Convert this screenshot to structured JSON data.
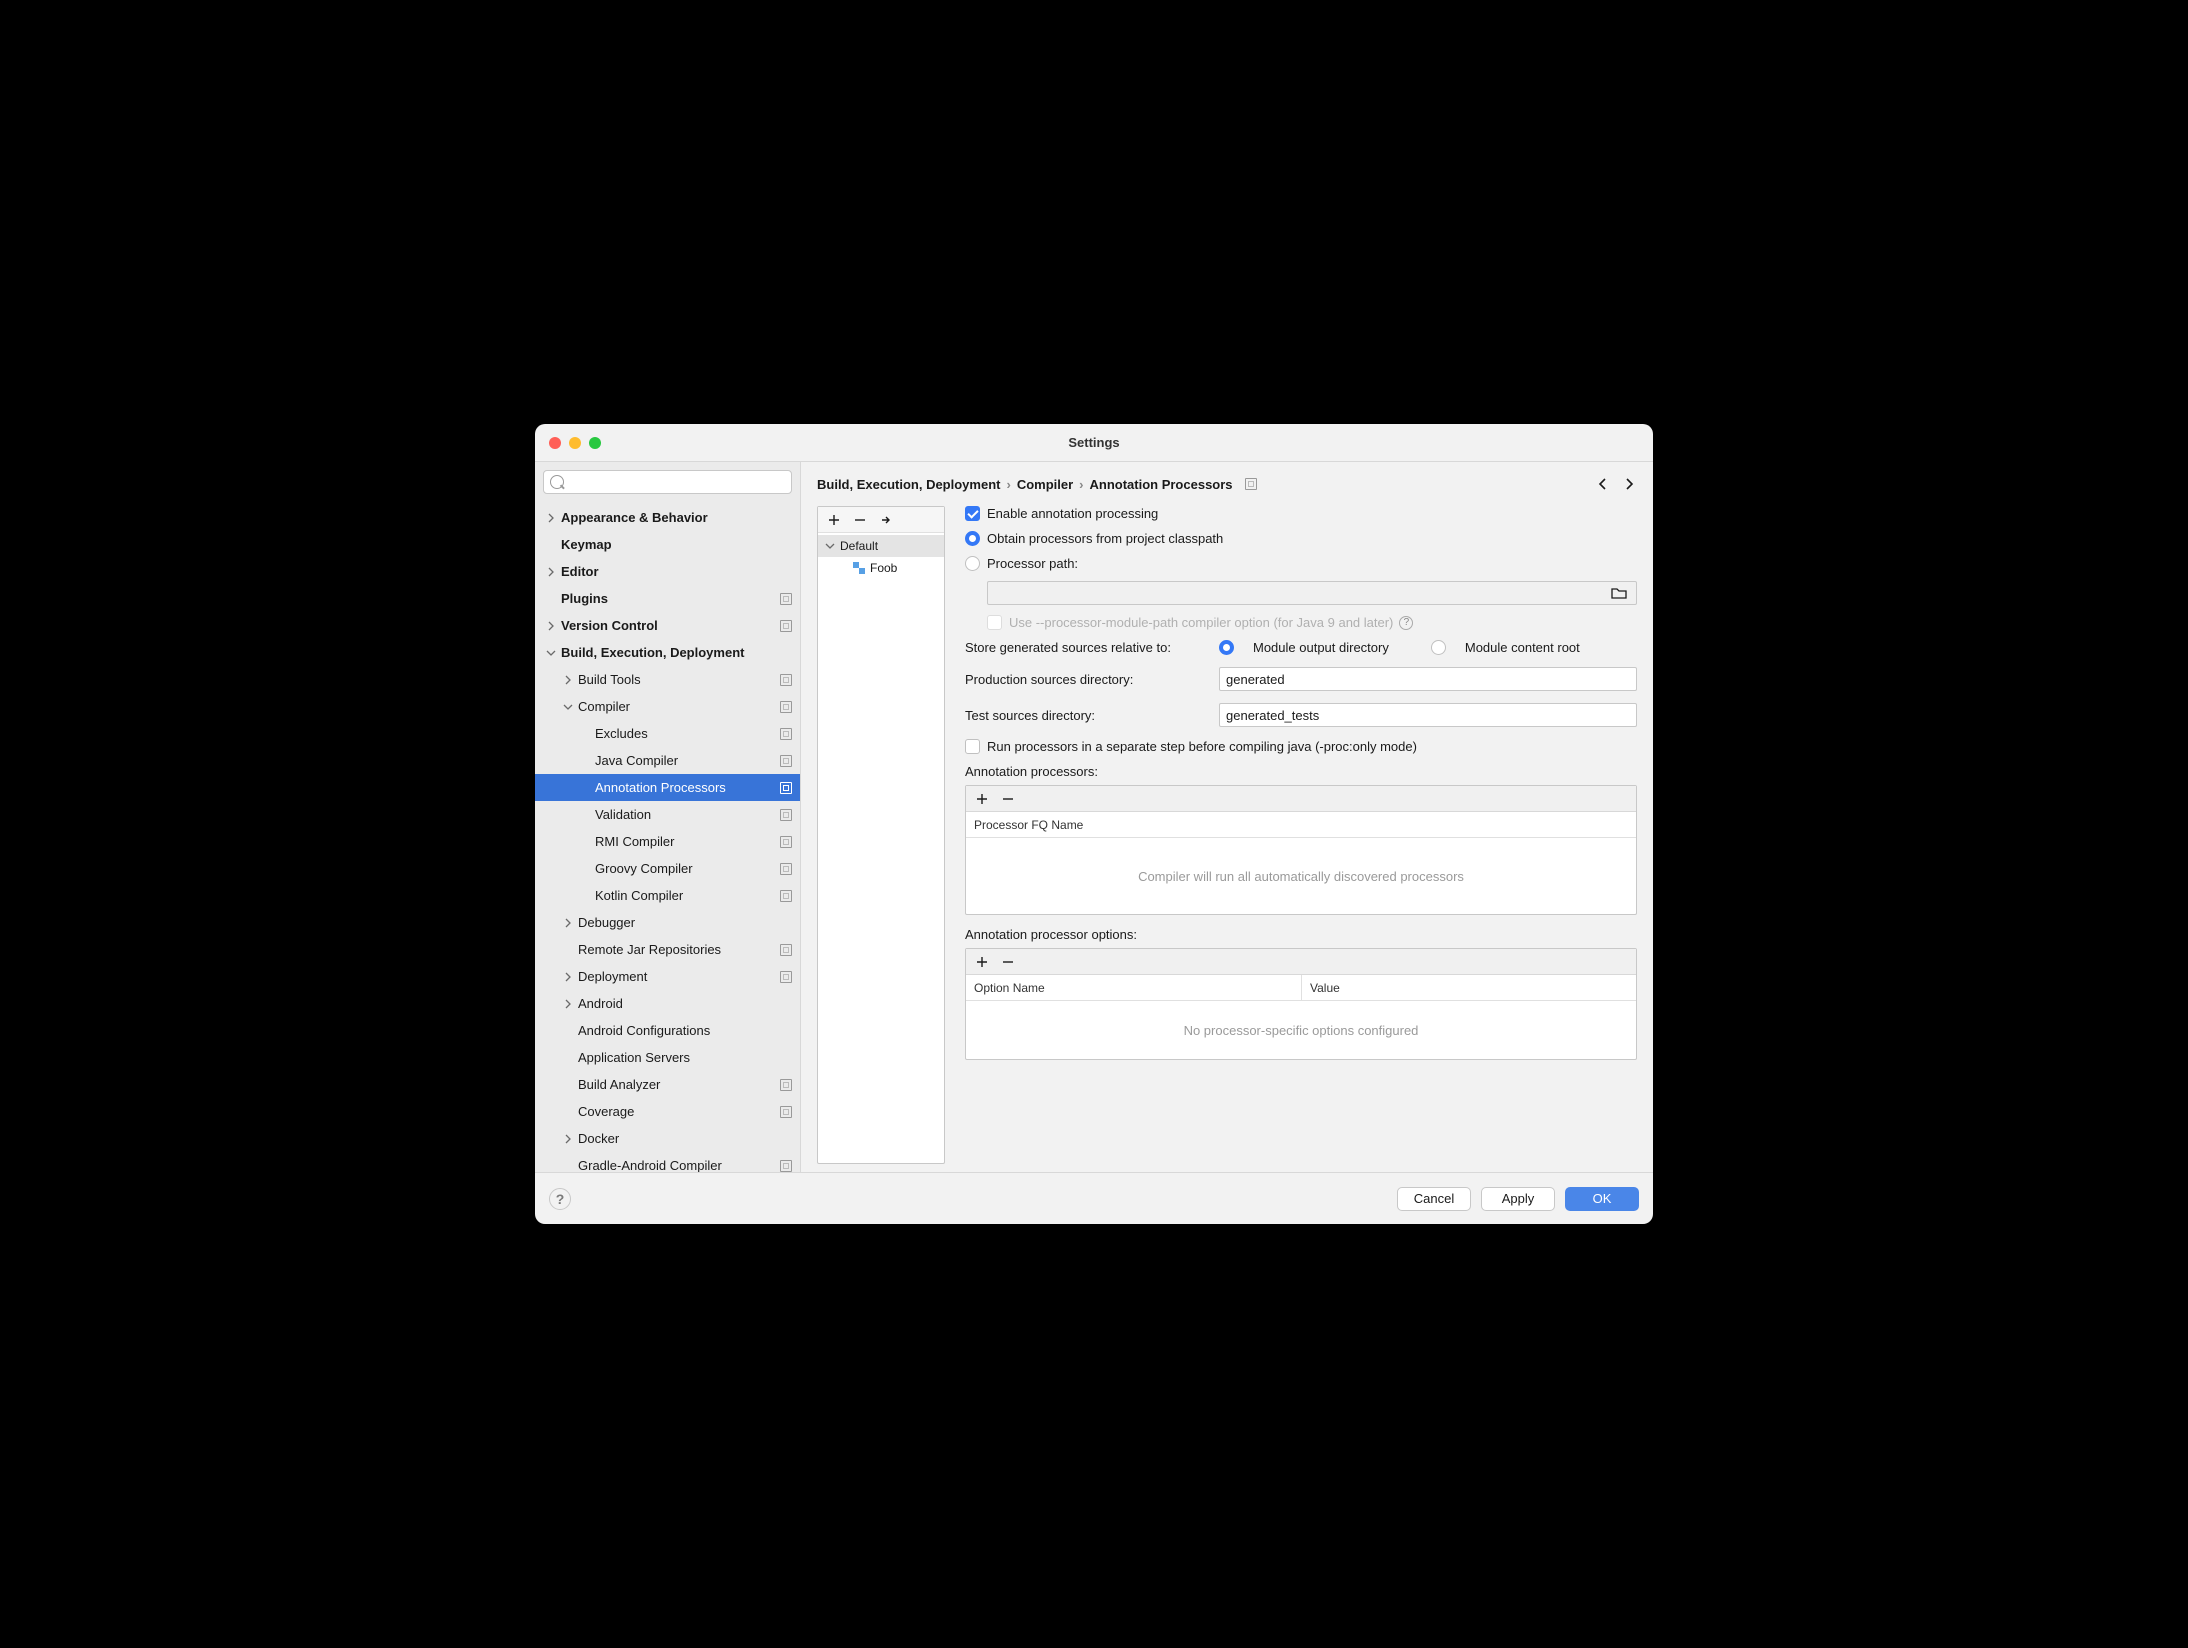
{
  "title": "Settings",
  "breadcrumb": [
    "Build, Execution, Deployment",
    "Compiler",
    "Annotation Processors"
  ],
  "sidebar": {
    "search_placeholder": "",
    "items": [
      {
        "label": "Appearance & Behavior",
        "bold": true,
        "chev": "right",
        "indent": 0,
        "sq": false
      },
      {
        "label": "Keymap",
        "bold": true,
        "chev": "none",
        "indent": 0,
        "sq": false
      },
      {
        "label": "Editor",
        "bold": true,
        "chev": "right",
        "indent": 0,
        "sq": false
      },
      {
        "label": "Plugins",
        "bold": true,
        "chev": "none",
        "indent": 0,
        "sq": true
      },
      {
        "label": "Version Control",
        "bold": true,
        "chev": "right",
        "indent": 0,
        "sq": true
      },
      {
        "label": "Build, Execution, Deployment",
        "bold": true,
        "chev": "down",
        "indent": 0,
        "sq": false
      },
      {
        "label": "Build Tools",
        "bold": false,
        "chev": "right",
        "indent": 1,
        "sq": true
      },
      {
        "label": "Compiler",
        "bold": false,
        "chev": "down",
        "indent": 1,
        "sq": true
      },
      {
        "label": "Excludes",
        "bold": false,
        "chev": "none",
        "indent": 2,
        "sq": true
      },
      {
        "label": "Java Compiler",
        "bold": false,
        "chev": "none",
        "indent": 2,
        "sq": true
      },
      {
        "label": "Annotation Processors",
        "bold": false,
        "chev": "none",
        "indent": 2,
        "sq": true,
        "selected": true
      },
      {
        "label": "Validation",
        "bold": false,
        "chev": "none",
        "indent": 2,
        "sq": true
      },
      {
        "label": "RMI Compiler",
        "bold": false,
        "chev": "none",
        "indent": 2,
        "sq": true
      },
      {
        "label": "Groovy Compiler",
        "bold": false,
        "chev": "none",
        "indent": 2,
        "sq": true
      },
      {
        "label": "Kotlin Compiler",
        "bold": false,
        "chev": "none",
        "indent": 2,
        "sq": true
      },
      {
        "label": "Debugger",
        "bold": false,
        "chev": "right",
        "indent": 1,
        "sq": false
      },
      {
        "label": "Remote Jar Repositories",
        "bold": false,
        "chev": "none",
        "indent": 1,
        "sq": true
      },
      {
        "label": "Deployment",
        "bold": false,
        "chev": "right",
        "indent": 1,
        "sq": true
      },
      {
        "label": "Android",
        "bold": false,
        "chev": "right",
        "indent": 1,
        "sq": false
      },
      {
        "label": "Android Configurations",
        "bold": false,
        "chev": "none",
        "indent": 1,
        "sq": false
      },
      {
        "label": "Application Servers",
        "bold": false,
        "chev": "none",
        "indent": 1,
        "sq": false
      },
      {
        "label": "Build Analyzer",
        "bold": false,
        "chev": "none",
        "indent": 1,
        "sq": true
      },
      {
        "label": "Coverage",
        "bold": false,
        "chev": "none",
        "indent": 1,
        "sq": true
      },
      {
        "label": "Docker",
        "bold": false,
        "chev": "right",
        "indent": 1,
        "sq": false
      },
      {
        "label": "Gradle-Android Compiler",
        "bold": false,
        "chev": "none",
        "indent": 1,
        "sq": true
      }
    ]
  },
  "profiles": {
    "root": "Default",
    "module": "Foob"
  },
  "form": {
    "enable_label": "Enable annotation processing",
    "obtain_label": "Obtain processors from project classpath",
    "path_label": "Processor path:",
    "module_path_label": "Use --processor-module-path compiler option (for Java 9 and later)",
    "store_label": "Store generated sources relative to:",
    "store_opt1": "Module output directory",
    "store_opt2": "Module content root",
    "prod_label": "Production sources directory:",
    "prod_value": "generated",
    "test_label": "Test sources directory:",
    "test_value": "generated_tests",
    "separate_label": "Run processors in a separate step before compiling java (-proc:only mode)",
    "proc_section": "Annotation processors:",
    "proc_header": "Processor FQ Name",
    "proc_empty": "Compiler will run all automatically discovered processors",
    "opt_section": "Annotation processor options:",
    "opt_header1": "Option Name",
    "opt_header2": "Value",
    "opt_empty": "No processor-specific options configured"
  },
  "footer": {
    "cancel": "Cancel",
    "apply": "Apply",
    "ok": "OK"
  }
}
